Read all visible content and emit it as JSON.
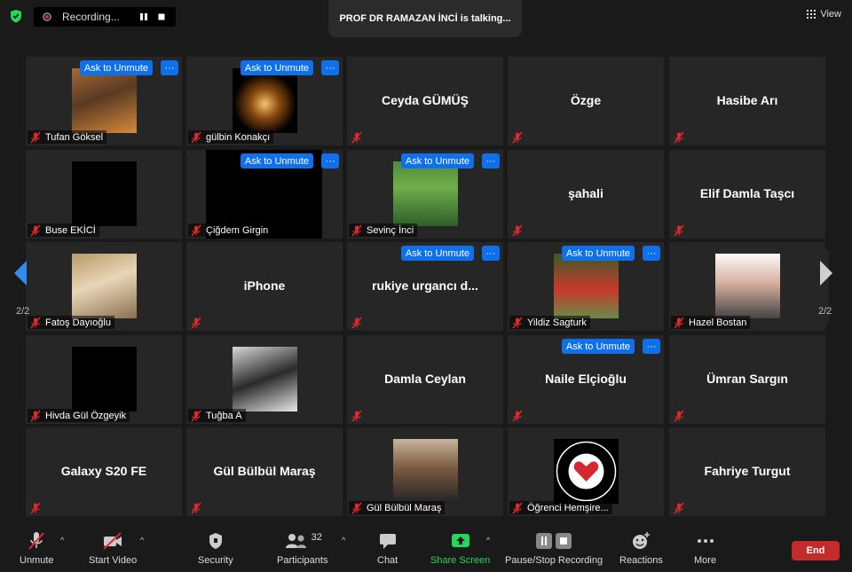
{
  "recording": {
    "label": "Recording..."
  },
  "talking": "PROF DR RAMAZAN İNCİ is talking...",
  "view_label": "View",
  "ask_label": "Ask to Unmute",
  "more_label": "···",
  "page_indicator": "2/2",
  "tiles": [
    {
      "name": "Tufan Göksel",
      "type": "video"
    },
    {
      "name": "gülbin Konakçı",
      "type": "video"
    },
    {
      "name": "Ceyda GÜMÜŞ",
      "type": "name"
    },
    {
      "name": "Özge",
      "type": "name"
    },
    {
      "name": "Hasibe Arı",
      "type": "name"
    },
    {
      "name": "Buse EKİCİ",
      "type": "black"
    },
    {
      "name": "Çiğdem Girgin",
      "type": "black"
    },
    {
      "name": "Sevinç İnci",
      "type": "video"
    },
    {
      "name": "şahali",
      "type": "name"
    },
    {
      "name": "Elif Damla Taşcı",
      "type": "name"
    },
    {
      "name": "Fatoş Dayıoğlu",
      "type": "video"
    },
    {
      "name": "iPhone",
      "type": "name"
    },
    {
      "name": "rukiye urgancı d...",
      "type": "name"
    },
    {
      "name": "Yildiz Sagturk",
      "type": "video"
    },
    {
      "name": "Hazel Bostan",
      "type": "video"
    },
    {
      "name": "Hivda Gül Özgeyik",
      "type": "black"
    },
    {
      "name": "Tuğba A",
      "type": "video"
    },
    {
      "name": "Damla Ceylan",
      "type": "name"
    },
    {
      "name": "Naile Elçioğlu",
      "type": "name"
    },
    {
      "name": "Ümran Sargın",
      "type": "name"
    },
    {
      "name": "Galaxy S20 FE",
      "type": "name"
    },
    {
      "name": "Gül Bülbül Maraş",
      "type": "name"
    },
    {
      "name": "Gül Bülbül Maraş",
      "type": "video"
    },
    {
      "name": "Öğrenci Hemşire...",
      "type": "logo"
    },
    {
      "name": "Fahriye Turgut",
      "type": "name"
    }
  ],
  "toolbar": {
    "unmute": "Unmute",
    "start_video": "Start Video",
    "security": "Security",
    "participants": "Participants",
    "participants_count": "32",
    "chat": "Chat",
    "share_screen": "Share Screen",
    "pause_recording": "Pause/Stop Recording",
    "reactions": "Reactions",
    "more": "More",
    "end": "End"
  },
  "colors": {
    "accent": "#0e71eb",
    "share": "#23d959",
    "end": "#c42b2b",
    "mute": "#e02828"
  }
}
